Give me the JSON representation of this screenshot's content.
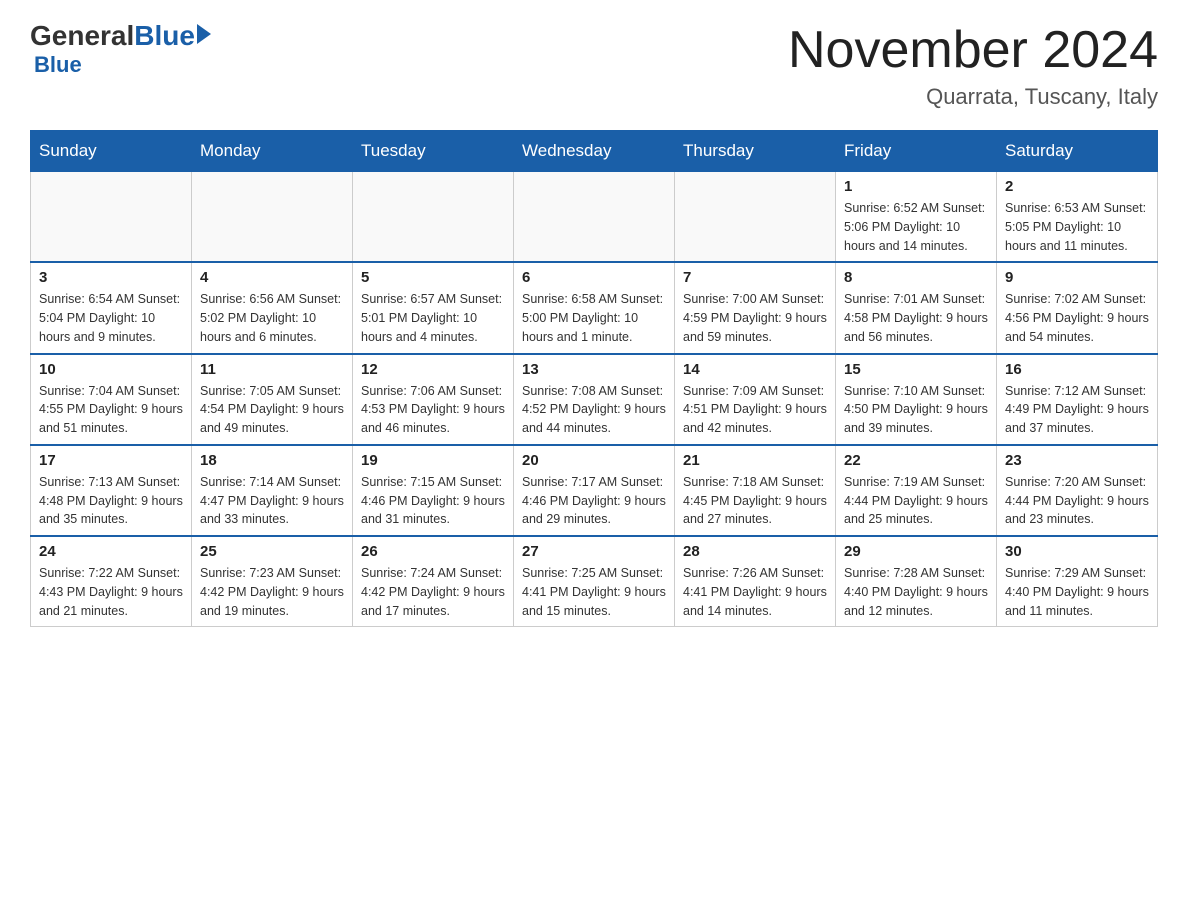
{
  "header": {
    "logo_general": "General",
    "logo_blue": "Blue",
    "title": "November 2024",
    "subtitle": "Quarrata, Tuscany, Italy"
  },
  "days_of_week": [
    "Sunday",
    "Monday",
    "Tuesday",
    "Wednesday",
    "Thursday",
    "Friday",
    "Saturday"
  ],
  "weeks": [
    [
      {
        "day": "",
        "info": ""
      },
      {
        "day": "",
        "info": ""
      },
      {
        "day": "",
        "info": ""
      },
      {
        "day": "",
        "info": ""
      },
      {
        "day": "",
        "info": ""
      },
      {
        "day": "1",
        "info": "Sunrise: 6:52 AM\nSunset: 5:06 PM\nDaylight: 10 hours\nand 14 minutes."
      },
      {
        "day": "2",
        "info": "Sunrise: 6:53 AM\nSunset: 5:05 PM\nDaylight: 10 hours\nand 11 minutes."
      }
    ],
    [
      {
        "day": "3",
        "info": "Sunrise: 6:54 AM\nSunset: 5:04 PM\nDaylight: 10 hours\nand 9 minutes."
      },
      {
        "day": "4",
        "info": "Sunrise: 6:56 AM\nSunset: 5:02 PM\nDaylight: 10 hours\nand 6 minutes."
      },
      {
        "day": "5",
        "info": "Sunrise: 6:57 AM\nSunset: 5:01 PM\nDaylight: 10 hours\nand 4 minutes."
      },
      {
        "day": "6",
        "info": "Sunrise: 6:58 AM\nSunset: 5:00 PM\nDaylight: 10 hours\nand 1 minute."
      },
      {
        "day": "7",
        "info": "Sunrise: 7:00 AM\nSunset: 4:59 PM\nDaylight: 9 hours\nand 59 minutes."
      },
      {
        "day": "8",
        "info": "Sunrise: 7:01 AM\nSunset: 4:58 PM\nDaylight: 9 hours\nand 56 minutes."
      },
      {
        "day": "9",
        "info": "Sunrise: 7:02 AM\nSunset: 4:56 PM\nDaylight: 9 hours\nand 54 minutes."
      }
    ],
    [
      {
        "day": "10",
        "info": "Sunrise: 7:04 AM\nSunset: 4:55 PM\nDaylight: 9 hours\nand 51 minutes."
      },
      {
        "day": "11",
        "info": "Sunrise: 7:05 AM\nSunset: 4:54 PM\nDaylight: 9 hours\nand 49 minutes."
      },
      {
        "day": "12",
        "info": "Sunrise: 7:06 AM\nSunset: 4:53 PM\nDaylight: 9 hours\nand 46 minutes."
      },
      {
        "day": "13",
        "info": "Sunrise: 7:08 AM\nSunset: 4:52 PM\nDaylight: 9 hours\nand 44 minutes."
      },
      {
        "day": "14",
        "info": "Sunrise: 7:09 AM\nSunset: 4:51 PM\nDaylight: 9 hours\nand 42 minutes."
      },
      {
        "day": "15",
        "info": "Sunrise: 7:10 AM\nSunset: 4:50 PM\nDaylight: 9 hours\nand 39 minutes."
      },
      {
        "day": "16",
        "info": "Sunrise: 7:12 AM\nSunset: 4:49 PM\nDaylight: 9 hours\nand 37 minutes."
      }
    ],
    [
      {
        "day": "17",
        "info": "Sunrise: 7:13 AM\nSunset: 4:48 PM\nDaylight: 9 hours\nand 35 minutes."
      },
      {
        "day": "18",
        "info": "Sunrise: 7:14 AM\nSunset: 4:47 PM\nDaylight: 9 hours\nand 33 minutes."
      },
      {
        "day": "19",
        "info": "Sunrise: 7:15 AM\nSunset: 4:46 PM\nDaylight: 9 hours\nand 31 minutes."
      },
      {
        "day": "20",
        "info": "Sunrise: 7:17 AM\nSunset: 4:46 PM\nDaylight: 9 hours\nand 29 minutes."
      },
      {
        "day": "21",
        "info": "Sunrise: 7:18 AM\nSunset: 4:45 PM\nDaylight: 9 hours\nand 27 minutes."
      },
      {
        "day": "22",
        "info": "Sunrise: 7:19 AM\nSunset: 4:44 PM\nDaylight: 9 hours\nand 25 minutes."
      },
      {
        "day": "23",
        "info": "Sunrise: 7:20 AM\nSunset: 4:44 PM\nDaylight: 9 hours\nand 23 minutes."
      }
    ],
    [
      {
        "day": "24",
        "info": "Sunrise: 7:22 AM\nSunset: 4:43 PM\nDaylight: 9 hours\nand 21 minutes."
      },
      {
        "day": "25",
        "info": "Sunrise: 7:23 AM\nSunset: 4:42 PM\nDaylight: 9 hours\nand 19 minutes."
      },
      {
        "day": "26",
        "info": "Sunrise: 7:24 AM\nSunset: 4:42 PM\nDaylight: 9 hours\nand 17 minutes."
      },
      {
        "day": "27",
        "info": "Sunrise: 7:25 AM\nSunset: 4:41 PM\nDaylight: 9 hours\nand 15 minutes."
      },
      {
        "day": "28",
        "info": "Sunrise: 7:26 AM\nSunset: 4:41 PM\nDaylight: 9 hours\nand 14 minutes."
      },
      {
        "day": "29",
        "info": "Sunrise: 7:28 AM\nSunset: 4:40 PM\nDaylight: 9 hours\nand 12 minutes."
      },
      {
        "day": "30",
        "info": "Sunrise: 7:29 AM\nSunset: 4:40 PM\nDaylight: 9 hours\nand 11 minutes."
      }
    ]
  ]
}
